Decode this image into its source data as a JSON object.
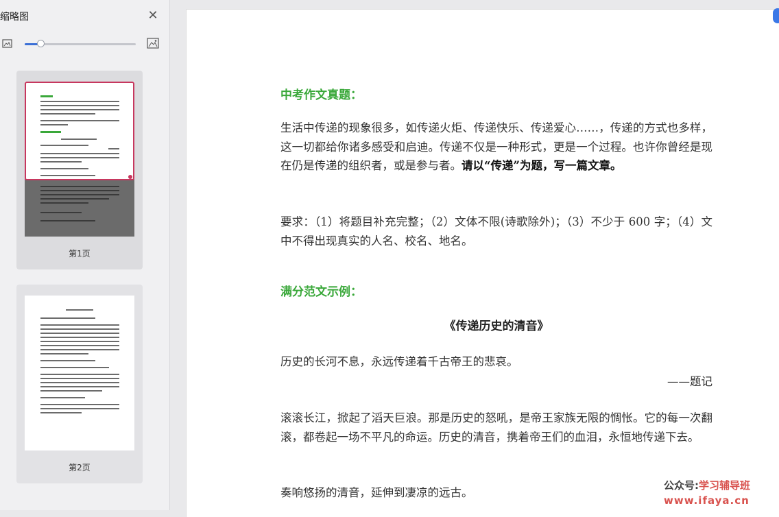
{
  "sidebar": {
    "title": "缩略图",
    "close_icon": "close-icon",
    "zoom_small_icon": "image-small-icon",
    "zoom_large_icon": "image-large-icon",
    "zoom_level": 0.14,
    "pages": [
      {
        "label": "第1页",
        "selected": true
      },
      {
        "label": "第2页",
        "selected": false
      }
    ]
  },
  "document": {
    "heading1": "中考作文真题：",
    "para1_normal": "生活中传递的现象很多，如传递火炬、传递快乐、传递爱心……，传递的方式也多样，这一切都给你诸多感受和启迪。传递不仅是一种形式，更是一个过程。也许你曾经是现在仍是传递的组织者，或是参与者。",
    "para1_bold": "请以“传递”为题，写一篇文章。",
    "requirement": "要求：（1）将题目补充完整；（2）文体不限(诗歌除外)；（3）不少于 600 字；（4）文中不得出现真实的人名、校名、地名。",
    "heading2": "满分范文示例：",
    "essay_title": "《传递历史的清音》",
    "line1": "历史的长河不息，永远传递着千古帝王的悲哀。",
    "note": "——题记",
    "para2": "滚滚长江，掀起了滔天巨浪。那是历史的怒吼，是帝王家族无限的惆怅。它的每一次翻滚，都卷起一场不平凡的命运。历史的清音，携着帝王们的血泪，永恒地传递下去。",
    "para3": "奏响悠扬的清音，延伸到凄凉的远古。"
  },
  "watermark": {
    "prefix": "公众号:",
    "name": "学习辅导班",
    "url": "www.ifaya.cn"
  },
  "colors": {
    "heading_green": "#3aa83a",
    "selection": "#c7375e",
    "accent_blue": "#3b6fd6",
    "watermark_red": "#d9534f"
  }
}
